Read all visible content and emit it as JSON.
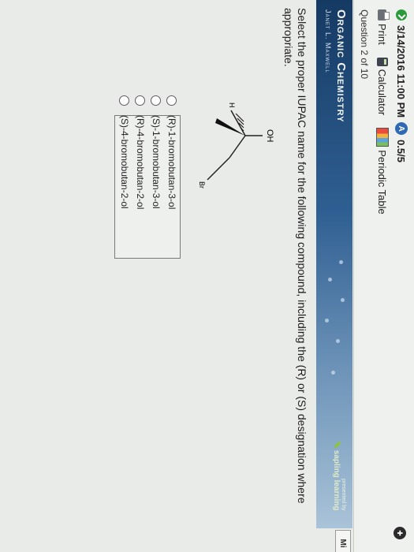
{
  "header": {
    "due_date": "3/14/2016 11:00 PM",
    "score": "0.5/5",
    "tools": [
      "Print",
      "Calculator",
      "Periodic Table"
    ],
    "question_counter": "Question 2 of 10",
    "corner_tab": "Mi"
  },
  "banner": {
    "title": "Organic Chemistry",
    "author": "Janet L. Maxwell",
    "presented_by": "presented by",
    "brand": "sapling learning"
  },
  "question": {
    "prompt": "Select the proper IUPAC name for the following compound, including the (R) or (S) designation where appropriate.",
    "structure_labels": {
      "oh": "OH",
      "h": "H",
      "br": "Br"
    }
  },
  "answers": {
    "selected": null,
    "choices": [
      "(R)-1-bromobutan-3-ol",
      "(S)-1-bromobutan-3-ol",
      "(R)-4-bromobutan-2-ol",
      "(S)-4-bromobutan-2-ol"
    ]
  }
}
